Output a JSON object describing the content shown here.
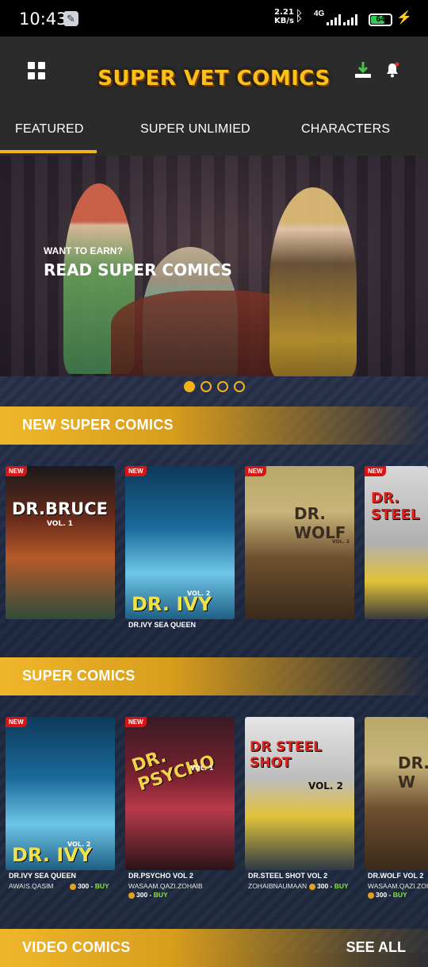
{
  "status_bar": {
    "time": "10:43",
    "speed": "2.21",
    "speed_unit": "KB/s",
    "network": "4G",
    "battery": "64"
  },
  "app": {
    "logo": "SUPER VET COMICS"
  },
  "tabs": [
    {
      "label": "FEATURED",
      "active": true
    },
    {
      "label": "SUPER UNLIMIED",
      "active": false
    },
    {
      "label": "CHARACTERS",
      "active": false
    }
  ],
  "hero": {
    "subtitle": "WANT TO EARN?",
    "title": "READ SUPER COMICS",
    "pages": 4,
    "active_page": 1
  },
  "sections": {
    "new_comics": {
      "title": "NEW SUPER COMICS",
      "items": [
        {
          "badge": "NEW",
          "cover_title": "DR.BRUCE",
          "cover_sub": "VOL. 1",
          "caption": ""
        },
        {
          "badge": "NEW",
          "cover_title": "DR. IVY",
          "cover_sub": "VOL. 2",
          "caption": "DR.IVY SEA QUEEN"
        },
        {
          "badge": "NEW",
          "cover_title": "DR. WOLF",
          "cover_sub": "VOL. 2",
          "caption": ""
        },
        {
          "badge": "NEW",
          "cover_title": "DR. STEEL",
          "cover_sub": "",
          "caption": ""
        }
      ]
    },
    "super_comics": {
      "title": "SUPER COMICS",
      "items": [
        {
          "badge": "NEW",
          "cover_title": "DR. IVY",
          "cover_sub": "VOL. 2",
          "caption": "DR.IVY SEA QUEEN",
          "author": "AWAIS.QASIM",
          "price": "300",
          "buy": "BUY"
        },
        {
          "badge": "NEW",
          "cover_title": "DR. PSYCHO",
          "cover_sub": "VOL. 1",
          "caption": "DR.PSYCHO VOL 2",
          "author": "WASAAM.QAZI.ZOHAIB",
          "price": "300",
          "buy": "BUY"
        },
        {
          "badge": "",
          "cover_title": "DR STEEL SHOT",
          "cover_sub": "VOL. 2",
          "caption": "DR.STEEL SHOT VOL 2",
          "author": "ZOHAIBNAUMAAN",
          "price": "300",
          "buy": "BUY"
        },
        {
          "badge": "",
          "cover_title": "DR. W",
          "cover_sub": "",
          "caption": "DR.WOLF VOL 2",
          "author": "WASAAM.QAZI.ZOHAIB",
          "price": "300",
          "buy": "BUY"
        }
      ]
    },
    "video_comics": {
      "title": "VIDEO COMICS",
      "see_all": "SEE ALL"
    }
  }
}
